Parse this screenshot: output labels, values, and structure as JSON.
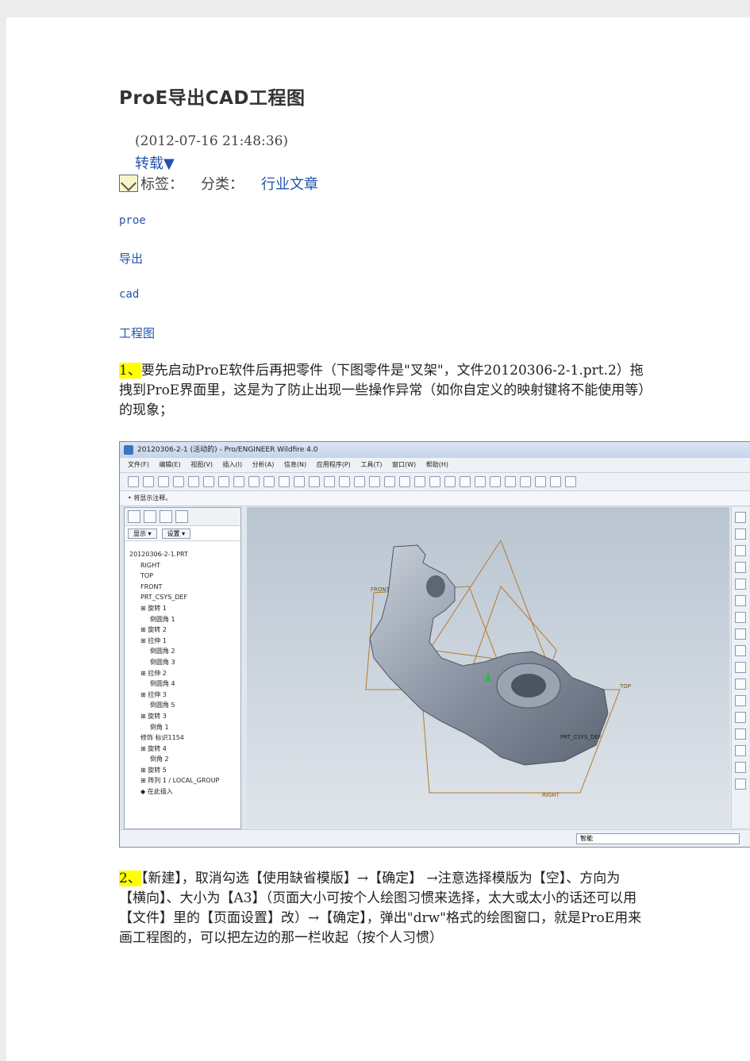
{
  "title": "ProE导出CAD工程图",
  "meta": {
    "datetime": "(2012-07-16 21:48:36)",
    "repost": "转载▼",
    "tags_label": "标签：",
    "category_label": "分类：",
    "category": "行业文章"
  },
  "keywords": [
    "proe",
    "导出",
    "cad",
    "工程图"
  ],
  "step1": {
    "num": "1、",
    "text": "要先启动ProE软件后再把零件（下图零件是\"叉架\"，文件20120306-2-1.prt.2）拖拽到ProE界面里，这是为了防止出现一些操作异常（如你自定义的映射键将不能使用等）的现象；"
  },
  "step2": {
    "num": "2、",
    "text": "【新建】，取消勾选【使用缺省模版】→【确定】 →注意选择模版为【空】、方向为【横向】、大小为【A3】（页面大小可按个人绘图习惯来选择，太大或太小的话还可以用【文件】里的【页面设置】改）→【确定】，弹出\"drw\"格式的绘图窗口，就是ProE用来画工程图的，可以把左边的那一栏收起（按个人习惯）"
  },
  "screenshot": {
    "window_title": "20120306-2-1 (活动的) - Pro/ENGINEER Wildfire 4.0",
    "menu": [
      "文件(F)",
      "编辑(E)",
      "视图(V)",
      "插入(I)",
      "分析(A)",
      "信息(N)",
      "应用程序(P)",
      "工具(T)",
      "窗口(W)",
      "帮助(H)"
    ],
    "hint": "• 将显示注释。",
    "show_btn": "显示 ▾",
    "settings_btn": "设置 ▾",
    "tree_root": "20120306-2-1.PRT",
    "tree": [
      "RIGHT",
      "TOP",
      "FRONT",
      "PRT_CSYS_DEF",
      "⊞ 旋转 1",
      "倒圆角 1",
      "⊞ 旋转 2",
      "⊞ 拉伸 1",
      "倒圆角 2",
      "倒圆角 3",
      "⊞ 拉伸 2",
      "倒圆角 4",
      "⊞ 拉伸 3",
      "倒圆角 5",
      "⊞ 旋转 3",
      "倒角 1",
      "修饰 标识1154",
      "⊞ 旋转 4",
      "倒角 2",
      "⊞ 旋转 5",
      "⊞ 阵列 1 / LOCAL_GROUP",
      "◆ 在此插入"
    ],
    "status_mode": "智能",
    "datum_labels": [
      "FRONT",
      "TOP",
      "RIGHT",
      "PRT_CSYS_DEF"
    ]
  }
}
